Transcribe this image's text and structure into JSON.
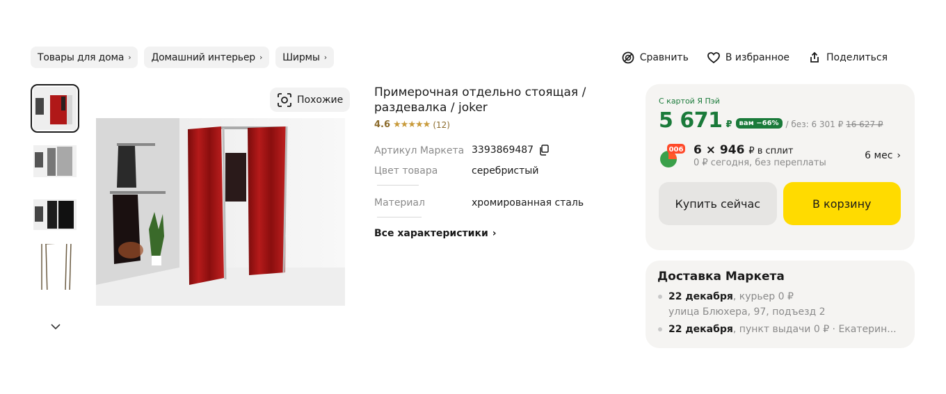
{
  "breadcrumbs": [
    {
      "label": "Товары для дома"
    },
    {
      "label": "Домашний интерьер"
    },
    {
      "label": "Ширмы"
    }
  ],
  "actions": {
    "compare": "Сравнить",
    "favorite": "В избранное",
    "share": "Поделиться"
  },
  "gallery": {
    "similar_label": "Похожие",
    "thumbnail_count": 4
  },
  "product": {
    "title": "Примерочная отдельно стоящая / раздевалка / joker",
    "rating": "4.6",
    "stars": "★★★★★",
    "reviews": "(12)",
    "specs": [
      {
        "key": "Артикул Маркета",
        "value": "3393869487"
      },
      {
        "key": "Цвет товара",
        "value": "серебристый"
      },
      {
        "key": "Материал",
        "value": "хромированная сталь"
      }
    ],
    "all_specs_label": "Все характеристики"
  },
  "price": {
    "card_label": "С картой Я Пэй",
    "current": "5 671",
    "currency": "₽",
    "badge": "вам −66%",
    "without_prefix": "/ без: ",
    "without_card": "6 301",
    "old": "16 627",
    "split_amount": "6 × 946",
    "split_suffix": "₽ в сплит",
    "split_note": "0 ₽ сегодня, без переплаты",
    "split_months": "6 мес",
    "buy_now": "Купить сейчас",
    "to_cart": "В корзину",
    "accent_color": "#1a7a3a",
    "cart_color": "#ffdb00"
  },
  "delivery": {
    "title": "Доставка Маркета",
    "items": [
      {
        "date": "22 декабря",
        "text": ", курьер  0 ₽",
        "sub": "улица Блюхера, 97, подъезд 2"
      },
      {
        "date": "22 декабря",
        "text": ", пункт выдачи  0 ₽ · Екатерин..."
      }
    ]
  }
}
